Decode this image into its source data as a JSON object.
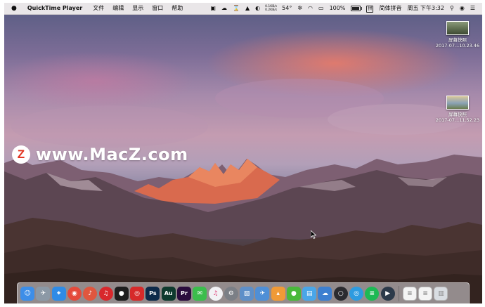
{
  "menubar": {
    "apple": "",
    "app_name": "QuickTime Player",
    "menus": [
      "文件",
      "编辑",
      "显示",
      "窗口",
      "帮助"
    ],
    "network_up": "0.1KB/s",
    "network_down": "0.2KB/s",
    "temperature": "54°",
    "battery": "100%",
    "input_method_badge": "拼",
    "input_method": "简体拼音",
    "clock": "周五 下午3:32"
  },
  "desktop_icons": [
    {
      "name": "屏幕快照",
      "date": "2017-07...10.23.46"
    },
    {
      "name": "屏幕快照",
      "date": "2017-07...11.52.23"
    }
  ],
  "watermark": {
    "logo": "Z",
    "text": "www.MacZ.com"
  },
  "dock": {
    "apps": [
      {
        "name": "finder-icon",
        "label": "",
        "color": "#3d8ee8"
      },
      {
        "name": "launchpad-icon",
        "label": "",
        "color": "#8c99a6"
      },
      {
        "name": "safari-icon",
        "label": "",
        "color": "#2f8be6"
      },
      {
        "name": "chrome-icon",
        "label": "",
        "color": "#e44a3b"
      },
      {
        "name": "netease-music-alt-icon",
        "label": "",
        "color": "#e0563e"
      },
      {
        "name": "netease-music-icon",
        "label": "",
        "color": "#d8282c"
      },
      {
        "name": "qq-icon",
        "label": "",
        "color": "#1e1e1e"
      },
      {
        "name": "weibo-icon",
        "label": "",
        "color": "#d62a2a"
      },
      {
        "name": "photoshop-icon",
        "label": "Ps",
        "color": "#0d2a4a"
      },
      {
        "name": "audition-icon",
        "label": "Au",
        "color": "#0e3a2e"
      },
      {
        "name": "premiere-icon",
        "label": "Pr",
        "color": "#2a0d3d"
      },
      {
        "name": "messages-icon",
        "label": "",
        "color": "#3bbd4c"
      },
      {
        "name": "itunes-icon",
        "label": "",
        "color": "#f2f2f5"
      },
      {
        "name": "system-preferences-icon",
        "label": "",
        "color": "#7b7f86"
      },
      {
        "name": "preview-icon",
        "label": "",
        "color": "#5e8fc8"
      },
      {
        "name": "mail-plane-icon",
        "label": "",
        "color": "#4f8fd6"
      },
      {
        "name": "fox-app-icon",
        "label": "",
        "color": "#f09a36"
      },
      {
        "name": "wechat-icon",
        "label": "",
        "color": "#49b93a"
      },
      {
        "name": "notes-blue-icon",
        "label": "",
        "color": "#4aa6e8"
      },
      {
        "name": "folder-cloud-icon",
        "label": "",
        "color": "#3d7fd0"
      },
      {
        "name": "obs-icon",
        "label": "",
        "color": "#2b2b2f"
      },
      {
        "name": "browser-blue-icon",
        "label": "",
        "color": "#2d9be0"
      },
      {
        "name": "spotify-icon",
        "label": "",
        "color": "#1db954"
      },
      {
        "name": "quicktime-icon",
        "label": "",
        "color": "#2c3a4a"
      }
    ],
    "docs": [
      {
        "name": "document-stack-1-icon",
        "color": "#f4f4f4"
      },
      {
        "name": "document-stack-2-icon",
        "color": "#f4f4f4"
      },
      {
        "name": "trash-icon",
        "color": "#d9dde2"
      }
    ]
  }
}
